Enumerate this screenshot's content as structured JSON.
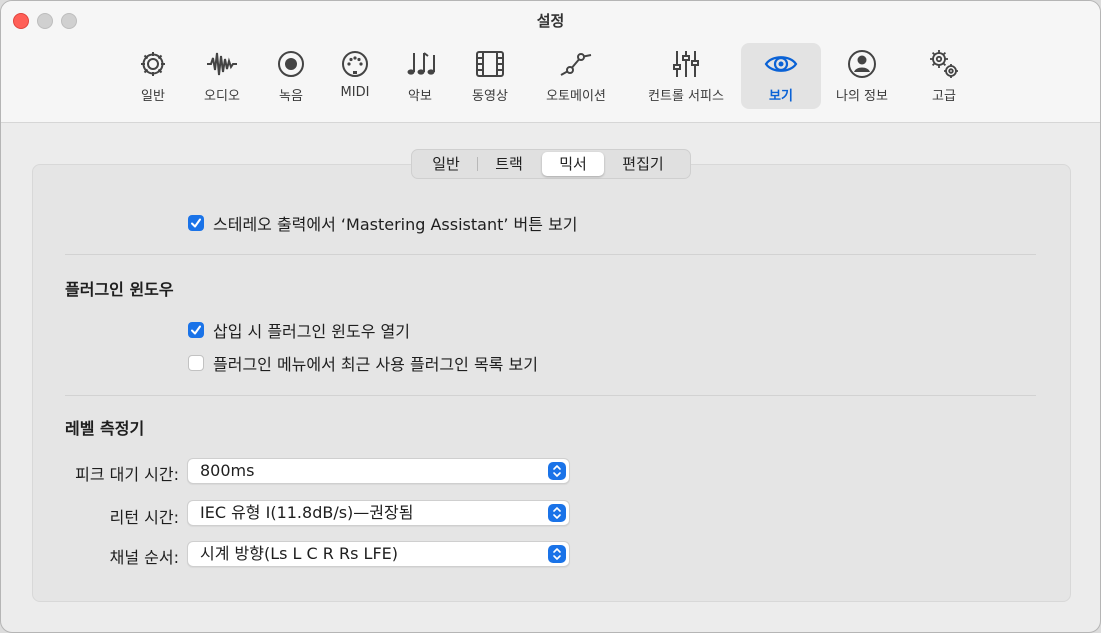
{
  "window": {
    "title": "설정"
  },
  "toolbar": {
    "tabs": [
      {
        "label": "일반",
        "icon": "gear-icon"
      },
      {
        "label": "오디오",
        "icon": "waveform-icon"
      },
      {
        "label": "녹음",
        "icon": "record-icon"
      },
      {
        "label": "MIDI",
        "icon": "midi-port-icon"
      },
      {
        "label": "악보",
        "icon": "music-notes-icon"
      },
      {
        "label": "동영상",
        "icon": "film-icon"
      },
      {
        "label": "오토메이션",
        "icon": "automation-icon"
      },
      {
        "label": "컨트롤 서피스",
        "icon": "sliders-icon"
      },
      {
        "label": "보기",
        "icon": "eye-icon"
      },
      {
        "label": "나의 정보",
        "icon": "person-icon"
      },
      {
        "label": "고급",
        "icon": "gears-icon"
      }
    ],
    "active_tab": "보기"
  },
  "subtabs": {
    "items": [
      "일반",
      "트랙",
      "믹서",
      "편집기"
    ],
    "active": "믹서"
  },
  "mixer": {
    "mastering_checkbox": {
      "label": "스테레오 출력에서 ‘Mastering Assistant’ 버튼 보기",
      "checked": true
    },
    "plugin_section": {
      "title": "플러그인 윈도우",
      "open_on_insert": {
        "label": "삽입 시 플러그인 윈도우 열기",
        "checked": true
      },
      "recent_list": {
        "label": "플러그인 메뉴에서 최근 사용 플러그인 목록 보기",
        "checked": false
      }
    },
    "meter_section": {
      "title": "레벨 측정기",
      "peak_hold": {
        "label": "피크 대기 시간:",
        "value": "800ms"
      },
      "return_time": {
        "label": "리턴 시간:",
        "value": "IEC 유형 I(11.8dB/s)—권장됨"
      },
      "channel_order": {
        "label": "채널 순서:",
        "value": "시계 방향(Ls L C R Rs LFE)"
      }
    }
  },
  "colors": {
    "accent": "#1a73e8",
    "close": "#ff5f57"
  }
}
